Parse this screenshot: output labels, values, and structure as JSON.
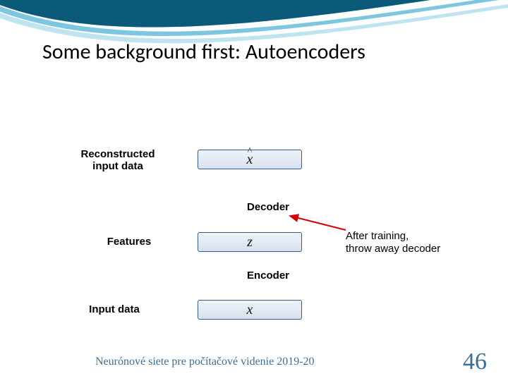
{
  "title": "Some background first: Autoencoders",
  "labels": {
    "reconstructed": "Reconstructed input data",
    "features": "Features",
    "input": "Input data",
    "decoder": "Decoder",
    "encoder": "Encoder"
  },
  "vars": {
    "xhat": "x",
    "xhat_accent": "^",
    "z": "z",
    "x": "x"
  },
  "note_line1": "After training,",
  "note_line2": "throw away decoder",
  "footer": "Neurónové siete pre počítačové videnie 2019-20",
  "page": "46"
}
